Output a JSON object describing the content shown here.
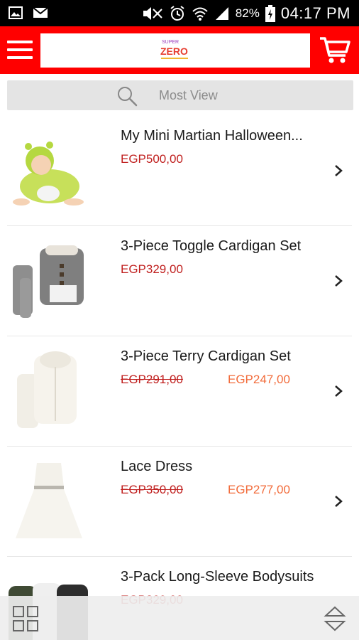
{
  "status_bar": {
    "battery_percent": "82%",
    "time": "04:17 PM",
    "icons": [
      "image-icon",
      "mail-icon",
      "mute-icon",
      "alarm-icon",
      "wifi-icon",
      "signal-icon",
      "battery-icon"
    ]
  },
  "header": {
    "logo_top_text": "SUPER",
    "logo_text": "ZERO",
    "colors": {
      "brand_red": "#ff0000"
    }
  },
  "search": {
    "placeholder": "Most View"
  },
  "products": [
    {
      "title": "My Mini Martian Halloween...",
      "price": "EGP500,00"
    },
    {
      "title": "3-Piece Toggle Cardigan Set",
      "price": "EGP329,00"
    },
    {
      "title": "3-Piece Terry Cardigan Set",
      "old_price": "EGP291,00",
      "new_price": "EGP247,00"
    },
    {
      "title": "Lace Dress",
      "old_price": "EGP350,00",
      "new_price": "EGP277,00"
    },
    {
      "title": "3-Pack Long-Sleeve Bodysuits",
      "price": "EGP329,00"
    }
  ]
}
